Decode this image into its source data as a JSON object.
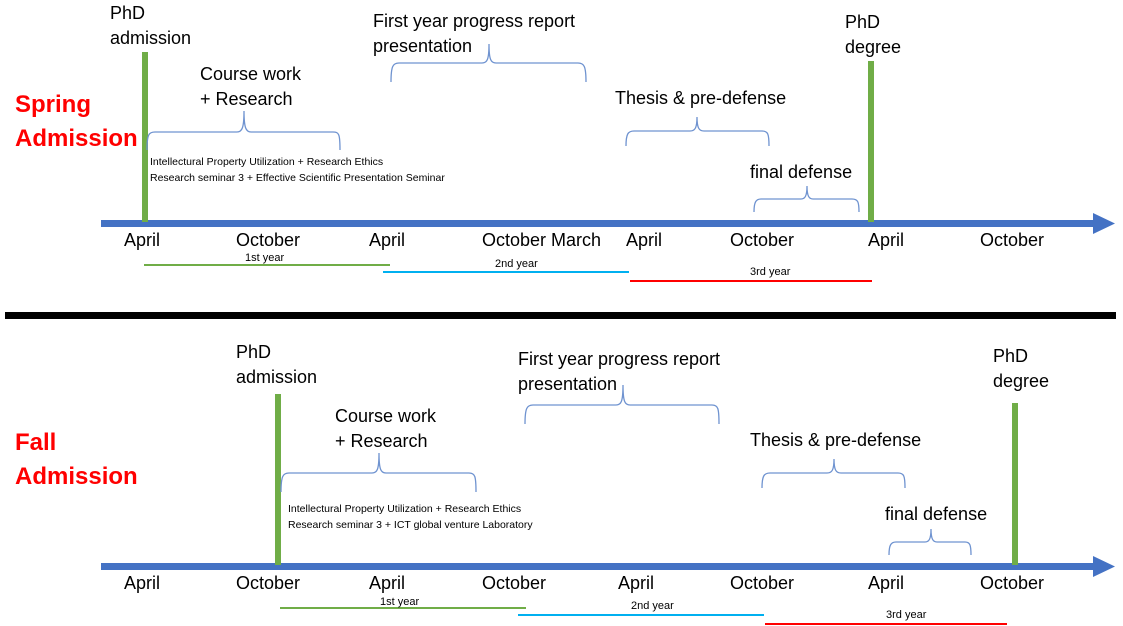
{
  "colors": {
    "axis": "#4472c4",
    "milestone": "#70ad47",
    "brace": "#6f93d0",
    "title": "#ff0000",
    "year1": "#70ad47",
    "year2": "#00b0f0",
    "year3": "#ff0000",
    "divider": "#000000"
  },
  "spring": {
    "title_line1": "Spring",
    "title_line2": "Admission",
    "admission_line1": "PhD",
    "admission_line2": "admission",
    "degree_line1": "PhD",
    "degree_line2": "degree",
    "coursework_line1": "Course work",
    "coursework_line2": "+ Research",
    "progress_line1": "First year progress report",
    "progress_line2": "presentation",
    "thesis": "Thesis & pre-defense",
    "final": "final defense",
    "courses_line1": "Intellectural Property Utilization + Research Ethics",
    "courses_line2": "Research seminar 3 + Effective Scientific Presentation Seminar",
    "ticks": [
      "April",
      "October",
      "April",
      "October",
      "March",
      "April",
      "October",
      "April",
      "October"
    ],
    "years": [
      "1st year",
      "2nd year",
      "3rd year"
    ]
  },
  "fall": {
    "title_line1": "Fall",
    "title_line2": "Admission",
    "admission_line1": "PhD",
    "admission_line2": "admission",
    "degree_line1": "PhD",
    "degree_line2": "degree",
    "coursework_line1": "Course work",
    "coursework_line2": "+ Research",
    "progress_line1": "First year progress report",
    "progress_line2": "presentation",
    "thesis": "Thesis & pre-defense",
    "final": "final defense",
    "courses_line1": "Intellectural Property Utilization + Research Ethics",
    "courses_line2": "Research seminar 3 + ICT global venture Laboratory",
    "ticks": [
      "April",
      "October",
      "April",
      "October",
      "April",
      "October",
      "April",
      "October"
    ],
    "years": [
      "1st year",
      "2nd year",
      "3rd year"
    ]
  }
}
